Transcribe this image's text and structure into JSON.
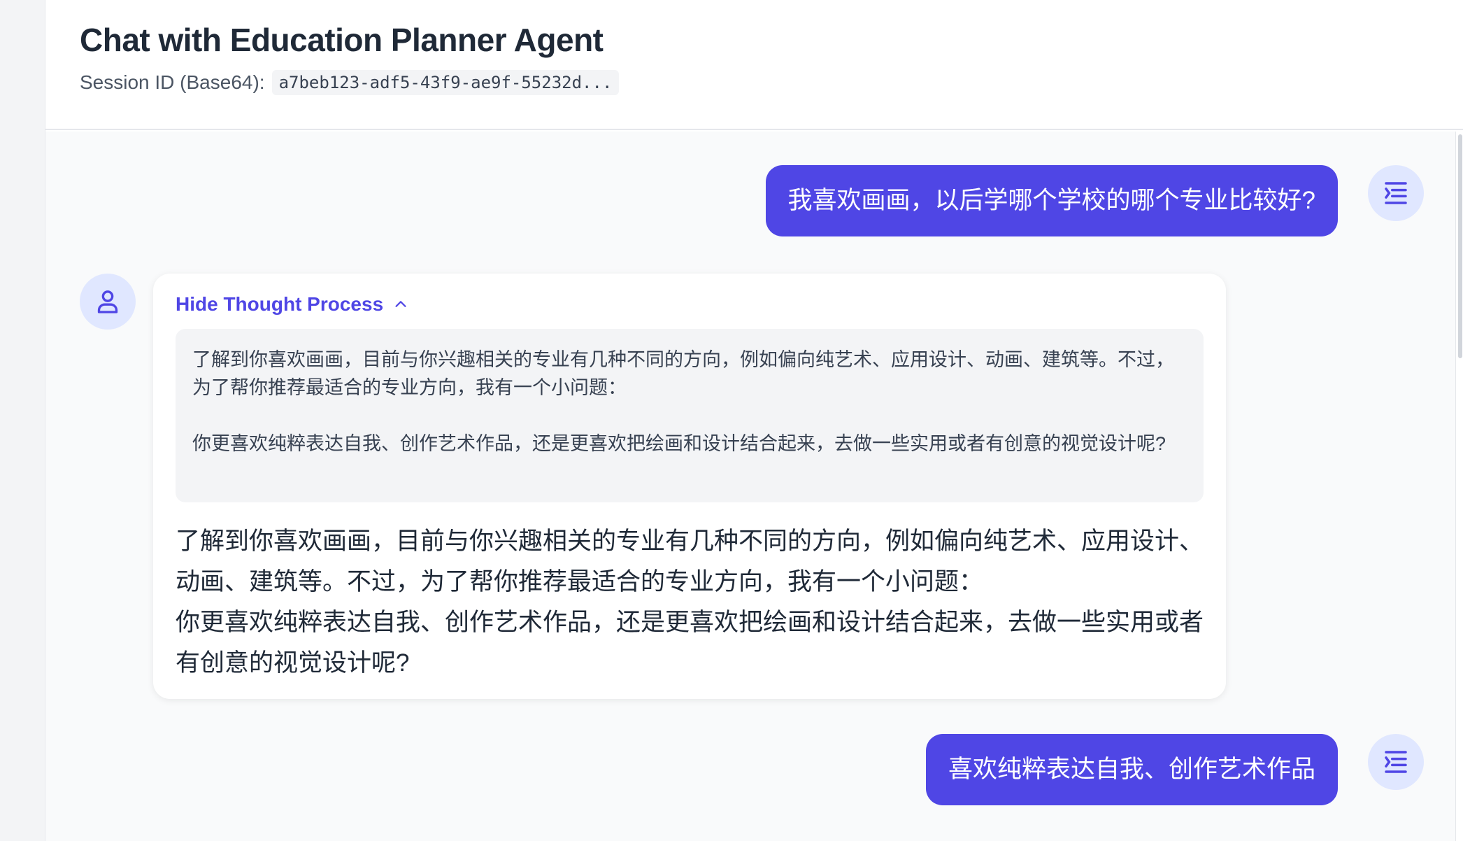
{
  "header": {
    "title": "Chat with Education Planner Agent",
    "session_label": "Session ID (Base64):",
    "session_value": "a7beb123-adf5-43f9-ae9f-55232d..."
  },
  "messages": {
    "user1": "我喜欢画画，以后学哪个学校的哪个专业比较好?",
    "bot1": {
      "toggle_label": "Hide Thought Process",
      "thought_line1": "了解到你喜欢画画，目前与你兴趣相关的专业有几种不同的方向，例如偏向纯艺术、应用设计、动画、建筑等。不过，为了帮你推荐最适合的专业方向，我有一个小问题：",
      "thought_line2": "你更喜欢纯粹表达自我、创作艺术作品，还是更喜欢把绘画和设计结合起来，去做一些实用或者有创意的视觉设计呢?",
      "answer_line1": "了解到你喜欢画画，目前与你兴趣相关的专业有几种不同的方向，例如偏向纯艺术、应用设计、动画、建筑等。不过，为了帮你推荐最适合的专业方向，我有一个小问题：",
      "answer_line2": "你更喜欢纯粹表达自我、创作艺术作品，还是更喜欢把绘画和设计结合起来，去做一些实用或者有创意的视觉设计呢?"
    },
    "user2": "喜欢纯粹表达自我、创作艺术作品"
  },
  "icons": {
    "user_avatar": "text-indent-icon",
    "bot_avatar": "person-icon",
    "toggle": "chevron-up-icon"
  },
  "colors": {
    "accent": "#4f46e5",
    "avatar_bg": "#e0e7ff",
    "thought_bg": "#f3f4f6"
  }
}
